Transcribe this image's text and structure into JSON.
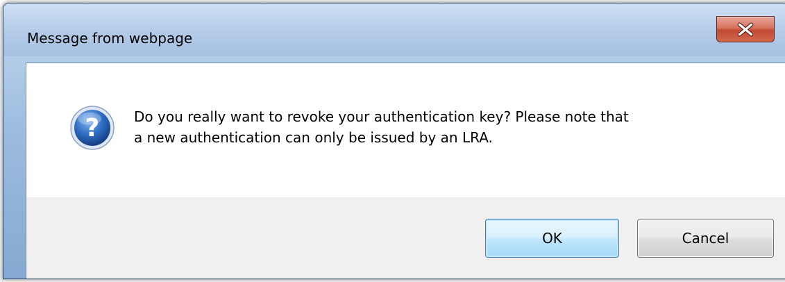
{
  "window": {
    "title": "Message from webpage"
  },
  "titlebar": {
    "close_icon": "close-x-icon"
  },
  "dialog": {
    "icon": "question-icon",
    "message_line1": "Do you really want to revoke your authentication key? Please note that",
    "message_line2": "a new authentication can only be issued by an LRA."
  },
  "buttons": {
    "ok_label": "OK",
    "cancel_label": "Cancel"
  },
  "colors": {
    "close_button": "#c14a33",
    "icon_blue": "#1f5fae",
    "ok_border": "#3c7fb1"
  }
}
